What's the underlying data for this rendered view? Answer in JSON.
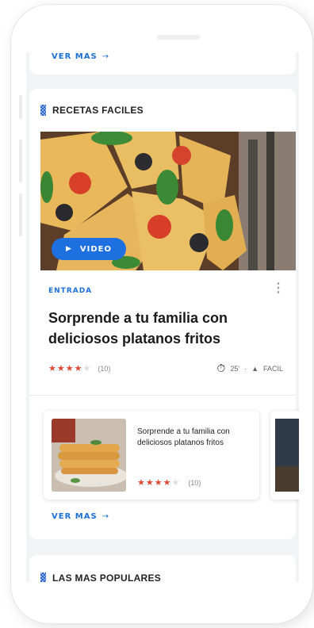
{
  "top_card": {
    "link_label": "VER MAS",
    "arrow": "→"
  },
  "section": {
    "title": "RECETAS FACILES",
    "icon": "checker-icon"
  },
  "featured": {
    "video_label": "VIDEO",
    "play_icon": "▶",
    "category": "ENTRADA",
    "title": "Sorprende a tu familia con deliciosos platanos fritos",
    "stars_on": "★★★★",
    "stars_off": "★",
    "rating_value": 4,
    "rating_max": 5,
    "rating_count": "(10)",
    "time_icon": "⏱",
    "time": "25'",
    "separator": "·",
    "difficulty_icon": "▲",
    "difficulty": "FACIL"
  },
  "carousel": {
    "items": [
      {
        "title": "Sorprende a tu familia con deliciosos platanos fritos",
        "stars_on": "★★★★",
        "stars_off": "★",
        "rating_value": 4,
        "rating_max": 5,
        "rating_count": "(10)"
      }
    ]
  },
  "more_link": {
    "label": "VER MAS",
    "arrow": "→"
  },
  "next_section": {
    "title": "LAS MAS POPULARES"
  },
  "colors": {
    "accent": "#1b6fd6",
    "stars": "#e04830",
    "video_button": "#1e6fe0"
  }
}
